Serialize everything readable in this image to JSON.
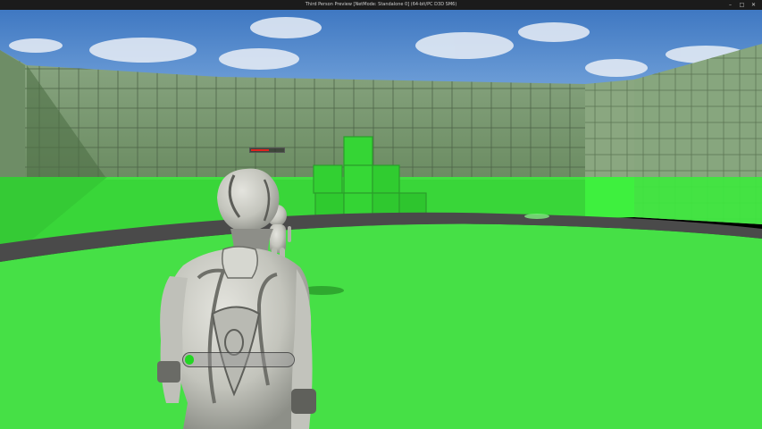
{
  "window": {
    "title": "Third Person Preview [NetMode: Standalone 0] (64-bit/PC D3D SM6)",
    "controls": [
      "–",
      "□",
      "✕"
    ]
  },
  "hud": {
    "player_health": 0.08,
    "enemy_health": 0.55,
    "player_health_color": "#23d623",
    "enemy_health_color": "#e0221f"
  },
  "scene": {
    "sky_color": "#4a82c7",
    "wall_color": "#7c9c72",
    "floor_color": "#46e046",
    "highlight_color": "#40f040",
    "track_color": "#4a4a4a",
    "character_color": "#c9cac3"
  }
}
